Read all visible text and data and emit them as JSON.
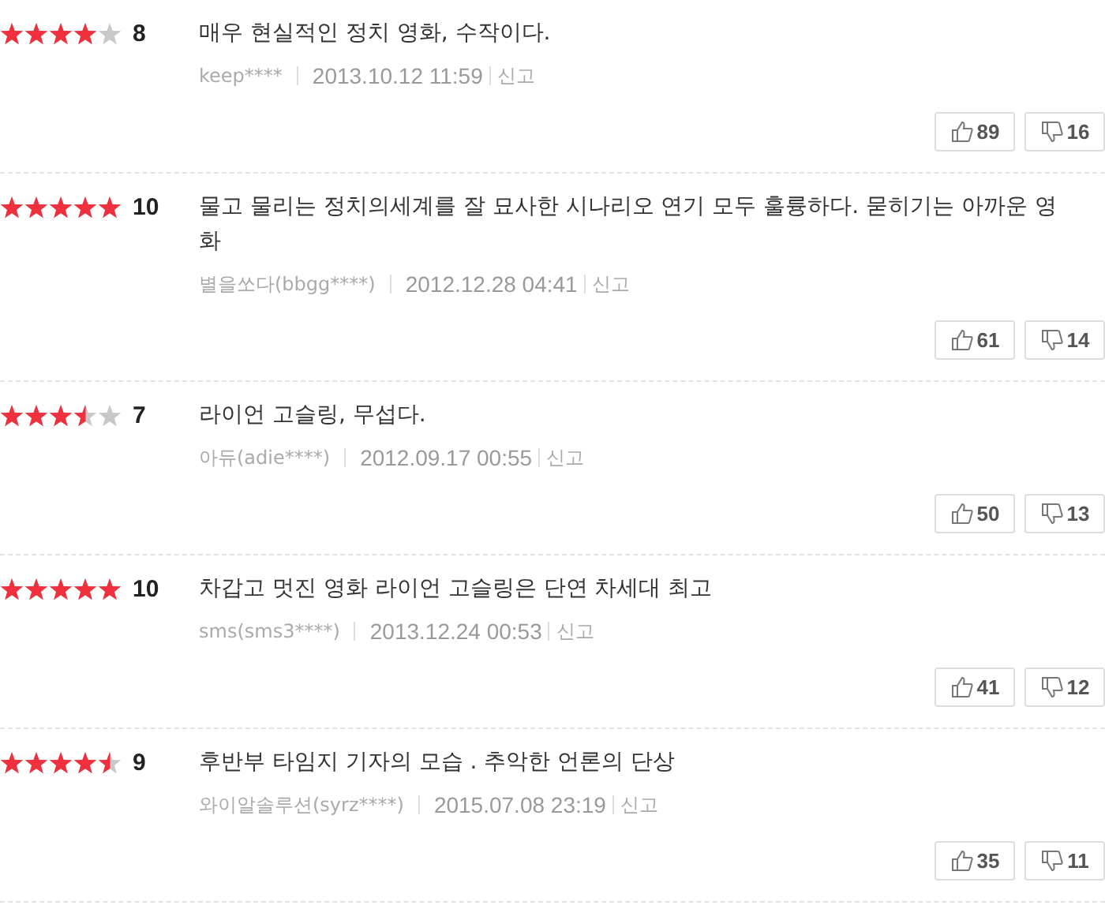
{
  "reviews": [
    {
      "stars": 4,
      "score": "8",
      "text": "매우 현실적인 정치 영화, 수작이다.",
      "user": "keep****",
      "date": "2013.10.12 11:59",
      "report": "신고",
      "likes": "89",
      "dislikes": "16"
    },
    {
      "stars": 5,
      "score": "10",
      "text": "물고 물리는 정치의세계를 잘 묘사한 시나리오 연기 모두 훌륭하다. 묻히기는 아까운 영화",
      "user": "별을쏘다(bbgg****)",
      "date": "2012.12.28 04:41",
      "report": "신고",
      "likes": "61",
      "dislikes": "14"
    },
    {
      "stars": 3.5,
      "score": "7",
      "text": "라이언 고슬링, 무섭다.",
      "user": "아듀(adie****)",
      "date": "2012.09.17 00:55",
      "report": "신고",
      "likes": "50",
      "dislikes": "13"
    },
    {
      "stars": 5,
      "score": "10",
      "text": "차갑고 멋진 영화 라이언 고슬링은 단연 차세대 최고",
      "user": "sms(sms3****)",
      "date": "2013.12.24 00:53",
      "report": "신고",
      "likes": "41",
      "dislikes": "12"
    },
    {
      "stars": 4.5,
      "score": "9",
      "text": "후반부 타임지 기자의 모습 . 추악한 언론의 단상",
      "user": "와이알솔루션(syrz****)",
      "date": "2015.07.08 23:19",
      "report": "신고",
      "likes": "35",
      "dislikes": "11"
    }
  ]
}
